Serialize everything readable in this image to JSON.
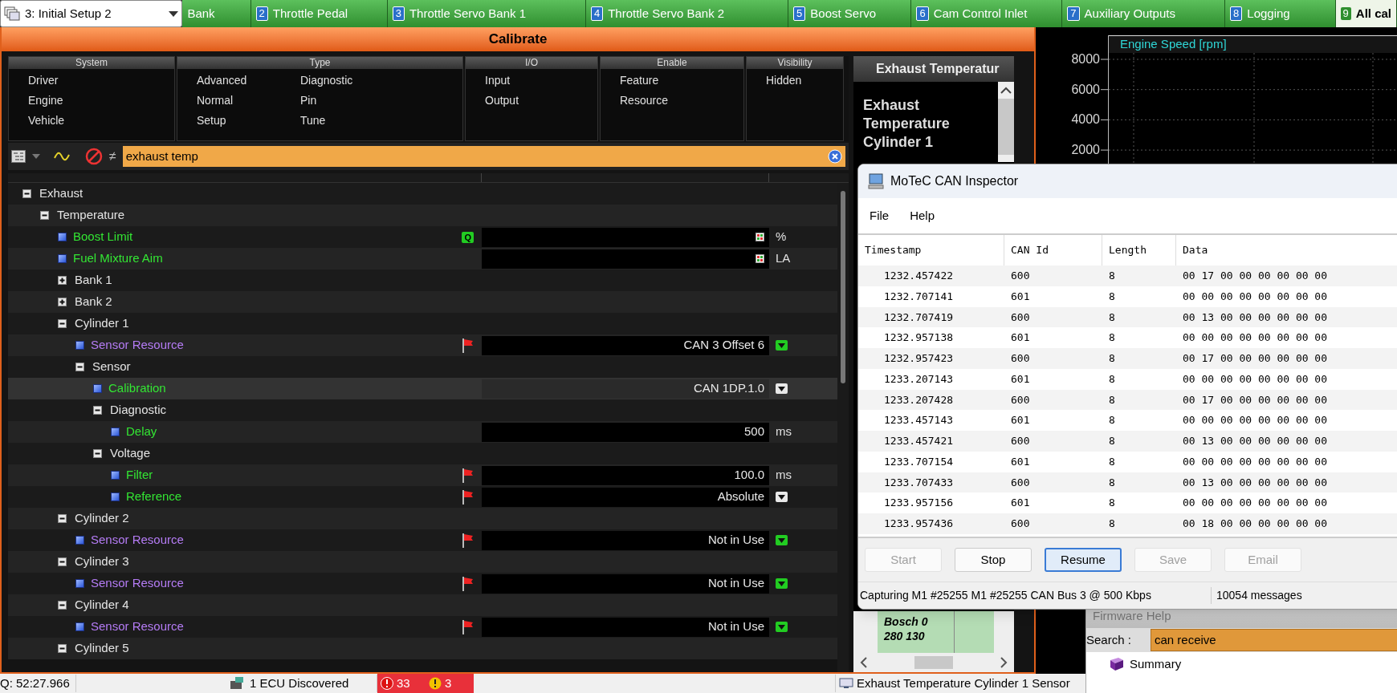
{
  "workbook": {
    "label": "3: Initial Setup 2"
  },
  "tabs": [
    {
      "label": "Bank",
      "selected": false
    },
    {
      "number": "2",
      "label": "Throttle Pedal",
      "selected": false
    },
    {
      "number": "3",
      "label": "Throttle Servo Bank 1",
      "selected": false
    },
    {
      "number": "4",
      "label": "Throttle Servo Bank 2",
      "selected": false
    },
    {
      "number": "5",
      "label": "Boost Servo",
      "selected": false
    },
    {
      "number": "6",
      "label": "Cam Control Inlet",
      "selected": false
    },
    {
      "number": "7",
      "label": "Auxiliary Outputs",
      "selected": false
    },
    {
      "number": "8",
      "label": "Logging",
      "selected": false
    },
    {
      "number": "9",
      "label": "All cal",
      "selected": true
    }
  ],
  "calibrate": {
    "title": "Calibrate",
    "filters": [
      {
        "heading": "System",
        "columns": [
          [
            "Driver",
            "Engine",
            "Vehicle"
          ]
        ]
      },
      {
        "heading": "Type",
        "columns": [
          [
            "Advanced",
            "Normal",
            "Setup"
          ],
          [
            "Diagnostic",
            "Pin",
            "Tune"
          ]
        ]
      },
      {
        "heading": "I/O",
        "columns": [
          [
            "Input",
            "Output"
          ]
        ]
      },
      {
        "heading": "Enable",
        "columns": [
          [
            "Feature",
            "Resource"
          ]
        ]
      },
      {
        "heading": "Visibility",
        "columns": [
          [
            "Hidden"
          ]
        ]
      }
    ],
    "search": {
      "value": "exhaust temp",
      "not_symbol": "≠"
    },
    "tree": [
      {
        "kind": "group",
        "label": "Exhaust",
        "expanded": true,
        "selected": false,
        "children": [
          {
            "kind": "group",
            "label": "Temperature",
            "expanded": true,
            "selected": false,
            "children": [
              {
                "kind": "param",
                "label": "Boost Limit",
                "color": "#33e633",
                "selected": false,
                "flagged": false,
                "badge": "Q",
                "units": "%",
                "table_button": true
              },
              {
                "kind": "param",
                "label": "Fuel Mixture Aim",
                "color": "#33e633",
                "selected": false,
                "flagged": false,
                "units": "LA",
                "table_button": true
              },
              {
                "kind": "group",
                "label": "Bank 1",
                "expanded": false,
                "selected": false
              },
              {
                "kind": "group",
                "label": "Bank 2",
                "expanded": false,
                "selected": false
              },
              {
                "kind": "group",
                "label": "Cylinder 1",
                "expanded": true,
                "selected": false,
                "children": [
                  {
                    "kind": "param",
                    "label": "Sensor Resource",
                    "color": "#b57cf5",
                    "selected": false,
                    "flagged": true,
                    "value": "CAN 3 Offset 6",
                    "table_button": false,
                    "dropdown": {
                      "color": "#22cc22"
                    }
                  },
                  {
                    "kind": "group",
                    "label": "Sensor",
                    "expanded": true,
                    "selected": false,
                    "children": [
                      {
                        "kind": "param",
                        "label": "Calibration",
                        "color": "#33e633",
                        "selected": true,
                        "flagged": false,
                        "value": "CAN 1DP.1.0",
                        "table_button": false,
                        "dropdown": {
                          "color": "#e8e8e8"
                        }
                      },
                      {
                        "kind": "group",
                        "label": "Diagnostic",
                        "expanded": true,
                        "selected": false,
                        "children": [
                          {
                            "kind": "param",
                            "label": "Delay",
                            "color": "#33e633",
                            "selected": false,
                            "flagged": false,
                            "value": "500",
                            "units": "ms",
                            "table_button": false
                          }
                        ]
                      },
                      {
                        "kind": "group",
                        "label": "Voltage",
                        "expanded": true,
                        "selected": false,
                        "children": [
                          {
                            "kind": "param",
                            "label": "Filter",
                            "color": "#33e633",
                            "selected": false,
                            "flagged": true,
                            "value": "100.0",
                            "units": "ms",
                            "table_button": false
                          },
                          {
                            "kind": "param",
                            "label": "Reference",
                            "color": "#33e633",
                            "selected": false,
                            "flagged": true,
                            "value": "Absolute",
                            "table_button": false,
                            "dropdown": {
                              "color": "#e8e8e8"
                            }
                          }
                        ]
                      }
                    ]
                  }
                ]
              },
              {
                "kind": "group",
                "label": "Cylinder 2",
                "expanded": true,
                "selected": false,
                "children": [
                  {
                    "kind": "param",
                    "label": "Sensor Resource",
                    "color": "#b57cf5",
                    "selected": false,
                    "flagged": true,
                    "value": "Not in Use",
                    "table_button": false,
                    "dropdown": {
                      "color": "#22cc22"
                    }
                  }
                ]
              },
              {
                "kind": "group",
                "label": "Cylinder 3",
                "expanded": true,
                "selected": false,
                "children": [
                  {
                    "kind": "param",
                    "label": "Sensor Resource",
                    "color": "#b57cf5",
                    "selected": false,
                    "flagged": true,
                    "value": "Not in Use",
                    "table_button": false,
                    "dropdown": {
                      "color": "#22cc22"
                    }
                  }
                ]
              },
              {
                "kind": "group",
                "label": "Cylinder 4",
                "expanded": true,
                "selected": false,
                "children": [
                  {
                    "kind": "param",
                    "label": "Sensor Resource",
                    "color": "#b57cf5",
                    "selected": false,
                    "flagged": true,
                    "value": "Not in Use",
                    "table_button": false,
                    "dropdown": {
                      "color": "#22cc22"
                    }
                  }
                ]
              },
              {
                "kind": "group",
                "label": "Cylinder 5",
                "expanded": true,
                "selected": false
              }
            ]
          }
        ]
      }
    ]
  },
  "help_panel": {
    "heading": "Exhaust Temperatur",
    "title": "Exhaust Temperature Cylinder 1",
    "table_cell": "Bosch 0 280 130"
  },
  "chart": {
    "title": "Engine Speed [rpm]",
    "y_labels": [
      "8000",
      "6000",
      "4000",
      "2000"
    ]
  },
  "can_inspector": {
    "title": "MoTeC CAN Inspector",
    "menu": [
      "File",
      "Help"
    ],
    "columns": [
      "Timestamp",
      "CAN Id",
      "Length",
      "Data"
    ],
    "rows": [
      [
        "1232.457422",
        "600",
        "8",
        "00 17 00 00 00 00 00 00"
      ],
      [
        "1232.707141",
        "601",
        "8",
        "00 00 00 00 00 00 00 00"
      ],
      [
        "1232.707419",
        "600",
        "8",
        "00 13 00 00 00 00 00 00"
      ],
      [
        "1232.957138",
        "601",
        "8",
        "00 00 00 00 00 00 00 00"
      ],
      [
        "1232.957423",
        "600",
        "8",
        "00 17 00 00 00 00 00 00"
      ],
      [
        "1233.207143",
        "601",
        "8",
        "00 00 00 00 00 00 00 00"
      ],
      [
        "1233.207428",
        "600",
        "8",
        "00 17 00 00 00 00 00 00"
      ],
      [
        "1233.457143",
        "601",
        "8",
        "00 00 00 00 00 00 00 00"
      ],
      [
        "1233.457421",
        "600",
        "8",
        "00 13 00 00 00 00 00 00"
      ],
      [
        "1233.707154",
        "601",
        "8",
        "00 00 00 00 00 00 00 00"
      ],
      [
        "1233.707433",
        "600",
        "8",
        "00 13 00 00 00 00 00 00"
      ],
      [
        "1233.957156",
        "601",
        "8",
        "00 00 00 00 00 00 00 00"
      ],
      [
        "1233.957436",
        "600",
        "8",
        "00 18 00 00 00 00 00 00"
      ]
    ],
    "buttons": [
      {
        "label": "Start",
        "disabled": true,
        "focused": false
      },
      {
        "label": "Stop",
        "disabled": false,
        "focused": false
      },
      {
        "label": "Resume",
        "disabled": false,
        "focused": true
      },
      {
        "label": "Save",
        "disabled": true,
        "focused": false
      },
      {
        "label": "Email",
        "disabled": true,
        "focused": false
      }
    ],
    "status": "Capturing M1 #25255 M1 #25255 CAN Bus 3 @ 500 Kbps",
    "message_count": "10054 messages"
  },
  "firmware_help": {
    "title": "Firmware Help",
    "search_label": "Search :",
    "search_value": "can receive",
    "items": [
      "Summary"
    ]
  },
  "status_bar": {
    "time": "Q: 52:27.966",
    "ecu": "1 ECU Discovered",
    "errors": "33",
    "warnings": "3",
    "message": "Exhaust Temperature Cylinder 1 Sensor"
  }
}
